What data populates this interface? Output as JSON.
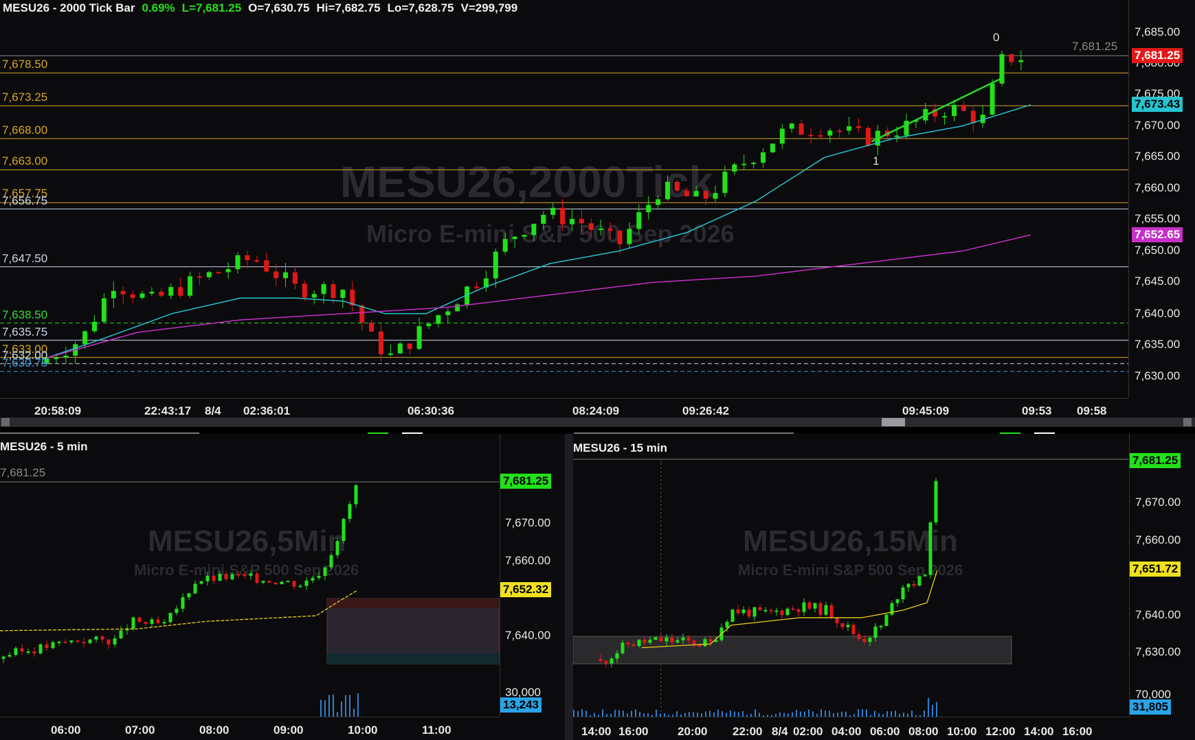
{
  "main_chart": {
    "header": {
      "symbol": "MESU26 - 2000 Tick Bar",
      "change": "0.69%",
      "last": "L=7,681.25",
      "open": "O=7,630.75",
      "high": "Hi=7,682.75",
      "low": "Lo=7,628.75",
      "volume": "V=299,799"
    },
    "watermark": "MESU26,2000Tick",
    "watermark_sub": "Micro E-mini S&P 500 Sep 2026",
    "price_axis": [
      "7,685.00",
      "7,680.00",
      "7,675.00",
      "7,670.00",
      "7,665.00",
      "7,660.00",
      "7,655.00",
      "7,650.00",
      "7,645.00",
      "7,640.00",
      "7,635.00",
      "7,630.00"
    ],
    "price_tags": {
      "last": "7,681.25",
      "ma_fast": "7,673.43",
      "ma_slow": "7,652.65",
      "last_ghost": "7,681.25"
    },
    "level_labels": [
      "7,678.50",
      "7,673.25",
      "7,668.00",
      "7,663.00",
      "7,657.75",
      "7,656.75",
      "7,647.50",
      "7,638.50",
      "7,635.75",
      "7,633.00",
      "7,632.00",
      "7,630.75"
    ],
    "time_axis": [
      "20:58:09",
      "22:43:17",
      "8/4",
      "02:36:01",
      "06:30:36",
      "08:24:09",
      "09:26:42",
      "09:45:09",
      "09:53",
      "09:58"
    ],
    "annotations": {
      "top_marker": "0",
      "bottom_marker": "1"
    },
    "colors": {
      "up": "#22e01a",
      "down": "#e21818",
      "ma_fast": "#27c3d0",
      "ma_slow": "#c62fc8",
      "level": "#d8a52a",
      "trend": "#26d82a"
    }
  },
  "chart_5min": {
    "title": "MESU26 - 5 min",
    "watermark": "MESU26,5Min",
    "watermark_sub": "Micro E-mini S&P 500 Sep 2026",
    "price_axis": [
      "7,670.00",
      "7,660.00",
      "7,640.00"
    ],
    "ghost_price": "7,681.25",
    "price_tags": {
      "last": "7,681.25",
      "ma": "7,652.32",
      "volume": "13,243"
    },
    "volume_axis": "30,000",
    "time_axis": [
      "06:00",
      "07:00",
      "08:00",
      "09:00",
      "10:00",
      "11:00"
    ]
  },
  "chart_15min": {
    "title": "MESU26 - 15 min",
    "watermark": "MESU26,15Min",
    "watermark_sub": "Micro E-mini S&P 500 Sep 2026",
    "price_axis": [
      "7,670.00",
      "7,660.00",
      "7,640.00",
      "7,630.00"
    ],
    "price_tags": {
      "last": "7,681.25",
      "ma": "7,651.72",
      "volume": "31,805"
    },
    "volume_axis": "70,000",
    "time_axis": [
      "14:00",
      "16:00",
      "20:00",
      "22:00",
      "8/4",
      "02:00",
      "04:00",
      "06:00",
      "08:00",
      "10:00",
      "12:00",
      "14:00",
      "16:00"
    ]
  }
}
